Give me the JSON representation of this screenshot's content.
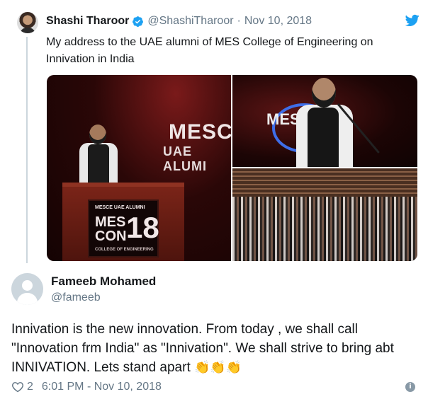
{
  "quoted_tweet": {
    "author_name": "Shashi Tharoor",
    "handle": "@ShashiTharoor",
    "separator": "·",
    "date": "Nov 10, 2018",
    "text": "My address to the UAE alumni of MES College of Engineering on Innivation in India",
    "verified": true,
    "media": {
      "main_sign_line1": "MESCE",
      "main_sign_line2": "UAE ALUMI",
      "podium_small": "MESCE UAE ALUMNI",
      "podium_mes": "MES",
      "podium_con": "CON",
      "podium_18": "18",
      "podium_sub": "COLLEGE OF ENGINEERING",
      "right_top_sign": "MESCE"
    }
  },
  "reply": {
    "author_name": "Fameeb Mohamed",
    "handle": "@fameeb",
    "text": "Innivation is the new innovation. From today , we shall call \"Innovation frm India\" as \"Innivation\". We shall strive to bring abt INNIVATION. Lets stand apart",
    "emoji": "👏👏👏",
    "likes": "2",
    "timestamp": "6:01 PM - Nov 10, 2018"
  },
  "icons": {
    "brand": "twitter-bird-icon",
    "verified": "verified-badge-icon",
    "like": "heart-icon",
    "info": "info-icon"
  },
  "colors": {
    "twitter_blue": "#1da1f2",
    "secondary_text": "#657786",
    "thread_line": "#ccd6dd"
  },
  "info_glyph": "i"
}
